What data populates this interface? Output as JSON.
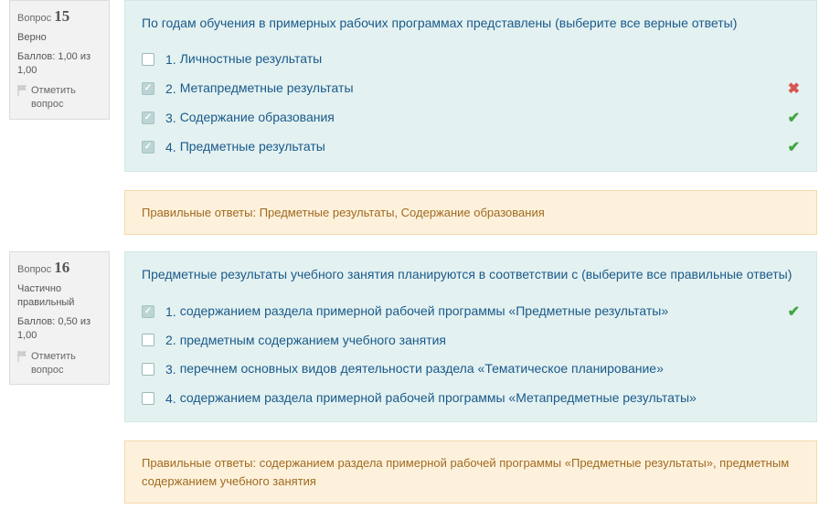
{
  "labels": {
    "question_prefix": "Вопрос",
    "flag_link": "Отметить вопрос",
    "feedback_prefix": "Правильные ответы:"
  },
  "questions": [
    {
      "number": "15",
      "state": "Верно",
      "mark": "Баллов: 1,00 из 1,00",
      "text": "По годам обучения в примерных рабочих программах представлены (выберите все верные ответы)",
      "answers": [
        {
          "no": "1.",
          "text": "Личностные результаты",
          "checked": false,
          "grade": ""
        },
        {
          "no": "2.",
          "text": "Метапредметные результаты",
          "checked": true,
          "grade": "incorrect"
        },
        {
          "no": "3.",
          "text": "Содержание образования",
          "checked": true,
          "grade": "correct"
        },
        {
          "no": "4.",
          "text": "Предметные результаты",
          "checked": true,
          "grade": "correct"
        }
      ],
      "feedback": "Предметные результаты, Содержание образования"
    },
    {
      "number": "16",
      "state": "Частично правильный",
      "mark": "Баллов: 0,50 из 1,00",
      "text": "Предметные результаты учебного занятия планируются в соответствии с (выберите все правильные ответы)",
      "answers": [
        {
          "no": "1.",
          "text": "содержанием раздела примерной рабочей программы «Предметные результаты»",
          "checked": true,
          "grade": "correct"
        },
        {
          "no": "2.",
          "text": "предметным содержанием учебного занятия",
          "checked": false,
          "grade": ""
        },
        {
          "no": "3.",
          "text": "перечнем основных видов деятельности раздела «Тематическое планирование»",
          "checked": false,
          "grade": ""
        },
        {
          "no": "4.",
          "text": "содержанием раздела примерной рабочей программы «Метапредметные результаты»",
          "checked": false,
          "grade": ""
        }
      ],
      "feedback": "содержанием раздела примерной рабочей программы «Предметные результаты», предметным содержанием учебного занятия"
    }
  ]
}
